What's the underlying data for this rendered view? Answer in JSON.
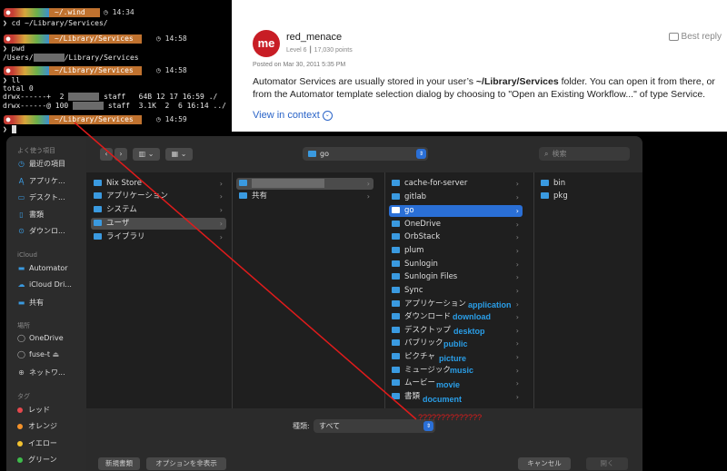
{
  "terminal": {
    "prompt_icon": "apple-icon",
    "blocks": [
      {
        "path": "~/.wind",
        "time": "◷ 14:34",
        "cmd": "cd ~/Library/Services/",
        "output": []
      },
      {
        "path": "~/Library/Services",
        "time": "◷ 14:58",
        "cmd": "pwd",
        "output": [
          "/Users/",
          "/Library/Services"
        ]
      },
      {
        "path": "~/Library/Services",
        "time": "◷ 14:58",
        "cmd": "ll",
        "output": [
          "total 0",
          "drwx------+  2",
          "staff   64B 12 17 16:59 ./",
          "drwx------@ 100",
          "staff  3.1K  2  6 16:14 ../"
        ]
      },
      {
        "path": "~/Library/Services",
        "time": "◷ 14:59",
        "cmd": "",
        "output": []
      }
    ]
  },
  "post": {
    "avatar": "me",
    "username": "red_menace",
    "level": "Level 6 ┃ 17,030 points",
    "best_reply": "Best reply",
    "posted": "Posted on Mar 30, 2011 5:35 PM",
    "body_1": "Automator Services are usually stored in your user’s ",
    "body_bold": "~/Library/Services",
    "body_2": " folder. You can open it from there, or from the Automator template selection dialog by choosing to \"Open an Existing Workflow...\" of type Service.",
    "view_context": "View in context"
  },
  "dialog": {
    "sidebar": {
      "favorites_header": "よく使う項目",
      "favorites": [
        {
          "icon": "clock-icon",
          "label": "最近の項目"
        },
        {
          "icon": "apps-icon",
          "label": "アプリケ..."
        },
        {
          "icon": "desktop-icon",
          "label": "デスクト..."
        },
        {
          "icon": "document-icon",
          "label": "書類"
        },
        {
          "icon": "download-icon",
          "label": "ダウンロ..."
        }
      ],
      "icloud_header": "iCloud",
      "icloud": [
        {
          "icon": "folder-icon",
          "label": "Automator"
        },
        {
          "icon": "cloud-icon",
          "label": "iCloud Dri..."
        },
        {
          "icon": "shared-folder-icon",
          "label": "共有"
        }
      ],
      "locations_header": "場所",
      "locations": [
        {
          "icon": "disk-icon",
          "label": "OneDrive"
        },
        {
          "icon": "disk-icon",
          "label": "fuse-t"
        },
        {
          "icon": "globe-icon",
          "label": "ネットワ..."
        }
      ],
      "tags_header": "タグ",
      "tags": [
        {
          "label": "レッド",
          "color": "#e5484d"
        },
        {
          "label": "オレンジ",
          "color": "#f5922a"
        },
        {
          "label": "イエロー",
          "color": "#f2c230"
        },
        {
          "label": "グリーン",
          "color": "#3ebc4b"
        }
      ]
    },
    "toolbar": {
      "back": "‹",
      "forward": "›",
      "location": "go",
      "search_placeholder": "検索"
    },
    "columns": {
      "col1": [
        "Nix Store",
        "アプリケーション",
        "システム",
        "ユーザ",
        "ライブラリ"
      ],
      "col2": [
        "",
        "共有"
      ],
      "col3": [
        "cache-for-server",
        "gitlab",
        "go",
        "OneDrive",
        "OrbStack",
        "plum",
        "Sunlogin",
        "Sunlogin Files",
        "Sync",
        "アプリケーション",
        "ダウンロード",
        "デスクトップ",
        "パブリック",
        "ピクチャ",
        "ミュージック",
        "ムービー",
        "書類"
      ],
      "col3_annotations": [
        "application",
        "download",
        "desktop",
        "public",
        "picture",
        "music",
        "movie",
        "document"
      ],
      "col4": [
        "bin",
        "pkg"
      ]
    },
    "annotation_marks": "??????????????",
    "format_label": "種類:",
    "format_value": "すべて",
    "new_folder": "新規書類",
    "hide_options": "オプションを非表示",
    "cancel": "キャンセル",
    "open": "開く"
  }
}
